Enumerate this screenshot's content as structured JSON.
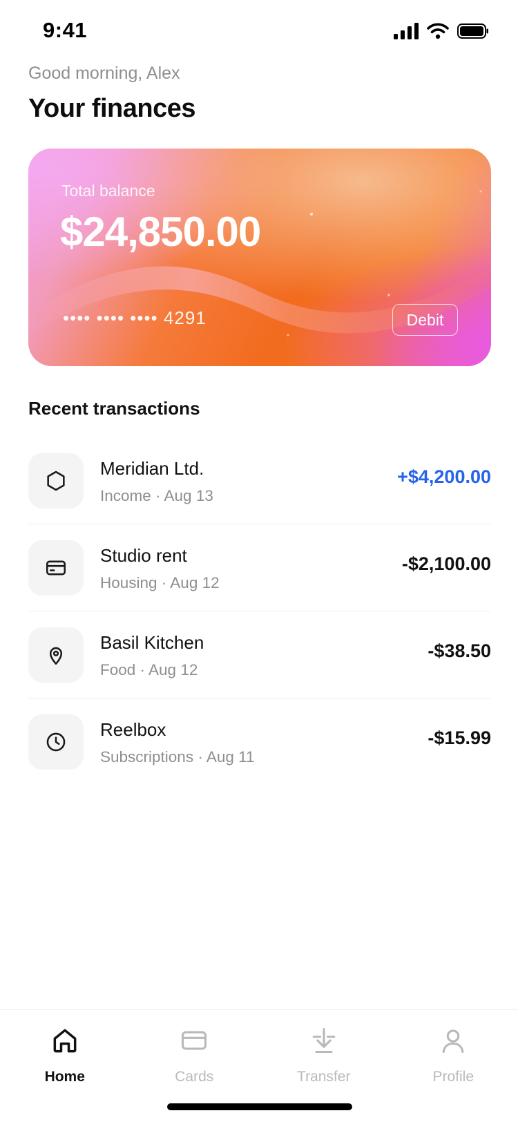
{
  "status_bar": {
    "time": "9:41"
  },
  "header": {
    "greeting": "Good morning, Alex",
    "title": "Your finances"
  },
  "balance_card": {
    "label": "Total balance",
    "amount": "$24,850.00",
    "card_number": "•••• •••• •••• 4291",
    "card_type": "Debit"
  },
  "transactions": {
    "title": "Recent transactions",
    "items": [
      {
        "name": "Meridian Ltd.",
        "meta": "Income · Aug 13",
        "amount": "+$4,200.00",
        "icon": "hexagon-icon"
      },
      {
        "name": "Studio rent",
        "meta": "Housing · Aug 12",
        "amount": "-$2,100.00",
        "icon": "card-icon"
      },
      {
        "name": "Basil Kitchen",
        "meta": "Food · Aug 12",
        "amount": "-$38.50",
        "icon": "location-pin-icon"
      },
      {
        "name": "Reelbox",
        "meta": "Subscriptions · Aug 11",
        "amount": "-$15.99",
        "icon": "clock-icon"
      }
    ]
  },
  "tab_bar": {
    "items": [
      {
        "label": "Home",
        "icon": "home-icon",
        "active": true
      },
      {
        "label": "Cards",
        "icon": "card-icon",
        "active": false
      },
      {
        "label": "Transfer",
        "icon": "transfer-icon",
        "active": false
      },
      {
        "label": "Profile",
        "icon": "profile-icon",
        "active": false
      }
    ]
  },
  "colors": {
    "positive_amount": "#2563eb",
    "muted_text": "#8e8e93",
    "card_gradient": [
      "#f3a0e6",
      "#f57a3a",
      "#f26b1e",
      "#ea5fd6"
    ]
  }
}
